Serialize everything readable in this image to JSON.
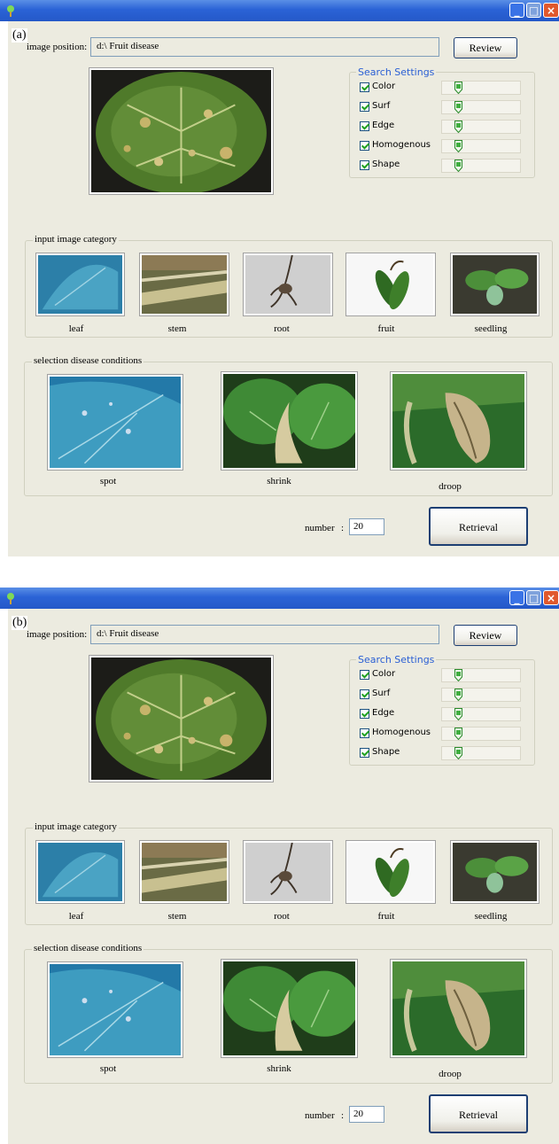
{
  "panels": [
    {
      "label": "(a)",
      "image_position_label": "image position:",
      "image_position_value": "d:\\ Fruit disease",
      "browse_label": "Review",
      "search_settings": {
        "title": "Search Settings",
        "options": [
          "Color",
          "Surf",
          "Edge",
          "Homogenous",
          "Shape"
        ]
      },
      "input_category": {
        "title": "input image category",
        "items": [
          "leaf",
          "stem",
          "root",
          "fruit",
          "seedling"
        ]
      },
      "disease": {
        "title": "selection disease conditions",
        "items": [
          "spot",
          "shrink",
          "droop"
        ]
      },
      "number_label": "number",
      "number_value": "20",
      "retrieval_label": "Retrieval"
    },
    {
      "label": "(b)",
      "image_position_label": "image position:",
      "image_position_value": "d:\\ Fruit disease",
      "browse_label": "Review",
      "search_settings": {
        "title": "Search Settings",
        "options": [
          "Color",
          "Surf",
          "Edge",
          "Homogenous",
          "Shape"
        ]
      },
      "input_category": {
        "title": "input image category",
        "items": [
          "leaf",
          "stem",
          "root",
          "fruit",
          "seedling"
        ]
      },
      "disease": {
        "title": "selection disease conditions",
        "items": [
          "spot",
          "shrink",
          "droop"
        ]
      },
      "number_label": "number",
      "number_value": "20",
      "retrieval_label": "Retrieval"
    }
  ],
  "colors": {
    "titlebar": "#2b63d6",
    "window_bg": "#ecebe0",
    "search_settings_title": "#2a5fd4",
    "check": "#21a121"
  }
}
